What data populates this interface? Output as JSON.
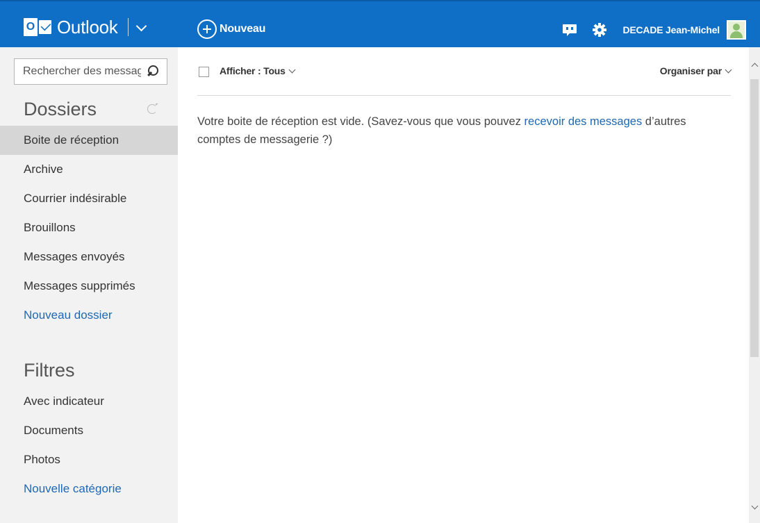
{
  "header": {
    "app_logo_letter": "O",
    "app_name": "Outlook",
    "new_button_label": "Nouveau",
    "user_name": "DECADE Jean-Michel",
    "brand_color": "#0f6fc6",
    "icons": [
      "outlook-logo-icon",
      "chevron-down-icon",
      "plus-circle-icon",
      "chat-icon",
      "gear-icon",
      "avatar"
    ]
  },
  "sidebar": {
    "search": {
      "placeholder": "Rechercher des messages",
      "value": ""
    },
    "folders_title": "Dossiers",
    "folders": [
      {
        "label": "Boite de réception",
        "active": true
      },
      {
        "label": "Archive"
      },
      {
        "label": "Courrier indésirable"
      },
      {
        "label": "Brouillons"
      },
      {
        "label": "Messages envoyés"
      },
      {
        "label": "Messages supprimés"
      },
      {
        "label": "Nouveau dossier",
        "link": true
      }
    ],
    "filters_title": "Filtres",
    "filters": [
      {
        "label": "Avec indicateur"
      },
      {
        "label": "Documents"
      },
      {
        "label": "Photos"
      },
      {
        "label": "Nouvelle catégorie",
        "link": true
      }
    ]
  },
  "main": {
    "filter_label": "Afficher : Tous",
    "sort_label": "Organiser par",
    "empty_message_pre": "Votre boite de réception est vide. (Savez-vous que vous pouvez ",
    "empty_message_link": "recevoir des messages",
    "empty_message_post": " d’autres comptes de messagerie ?)",
    "link_color": "#1e68b3"
  }
}
